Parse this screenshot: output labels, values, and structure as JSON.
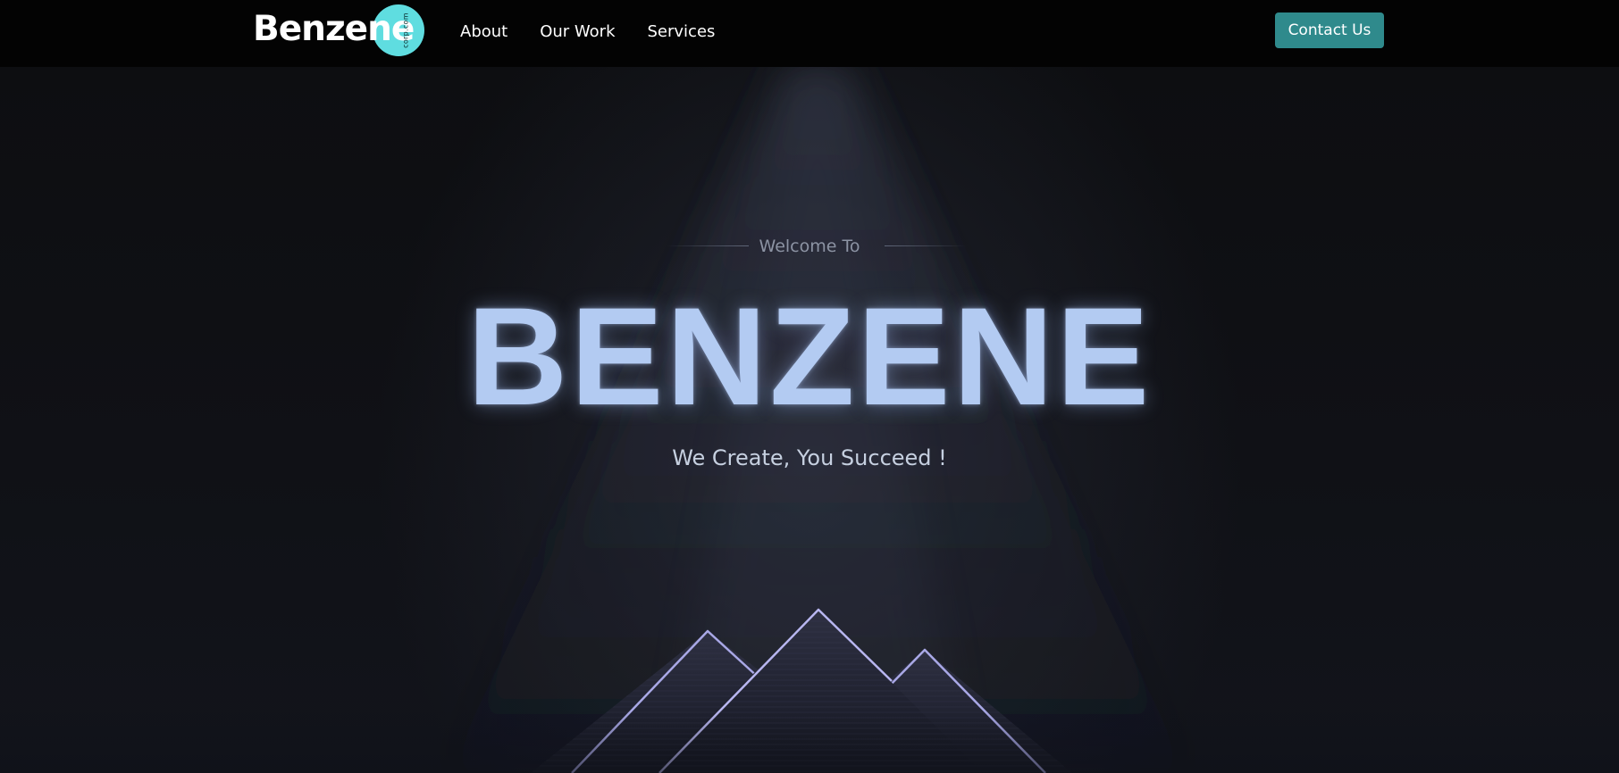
{
  "nav": {
    "logo_text": "Benzene",
    "logo_subtext": "corp.com",
    "links": [
      {
        "label": "About"
      },
      {
        "label": "Our Work"
      },
      {
        "label": "Services"
      }
    ],
    "cta_label": "Contact Us"
  },
  "hero": {
    "eyebrow": "Welcome To",
    "title": "BENZENE",
    "tagline": "We Create, You Succeed !"
  },
  "colors": {
    "nav_background": "#030303",
    "logo_circle": "#5fdde0",
    "cta_background": "#2f8a8c",
    "title_color": "#b3cbf2",
    "mountain_outline": "#a9a8e6"
  },
  "icons": {
    "decoration": "mountain-peaks-icon"
  }
}
